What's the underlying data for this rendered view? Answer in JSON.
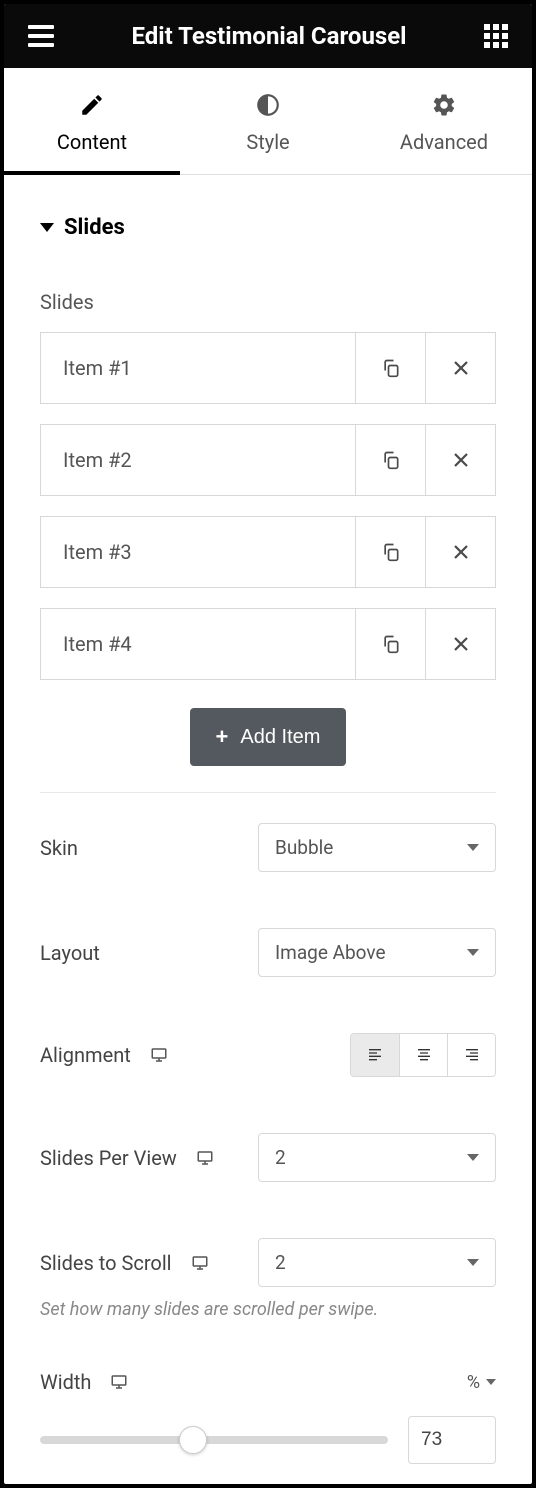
{
  "header": {
    "title": "Edit Testimonial Carousel"
  },
  "tabs": {
    "content": "Content",
    "style": "Style",
    "advanced": "Advanced",
    "active": "content"
  },
  "section": {
    "title": "Slides",
    "items_label": "Slides",
    "items": [
      {
        "name": "Item #1"
      },
      {
        "name": "Item #2"
      },
      {
        "name": "Item #3"
      },
      {
        "name": "Item #4"
      }
    ],
    "add_item_label": "Add Item"
  },
  "controls": {
    "skin": {
      "label": "Skin",
      "value": "Bubble"
    },
    "layout": {
      "label": "Layout",
      "value": "Image Above"
    },
    "alignment": {
      "label": "Alignment",
      "active": "left"
    },
    "slides_per_view": {
      "label": "Slides Per View",
      "value": "2"
    },
    "slides_to_scroll": {
      "label": "Slides to Scroll",
      "value": "2",
      "helper": "Set how many slides are scrolled per swipe."
    },
    "width": {
      "label": "Width",
      "unit": "%",
      "value": "73",
      "slider_percent": 44
    }
  }
}
